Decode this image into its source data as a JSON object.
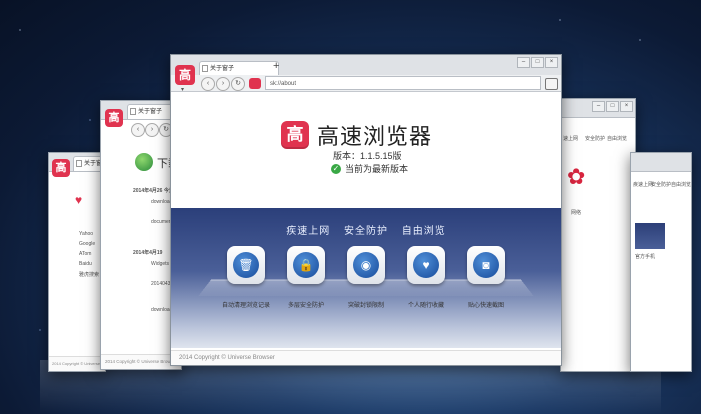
{
  "app": {
    "logo_char": "高",
    "title": "高速浏览器",
    "version": "版本：1.1.5.15版",
    "status": "当前为最新版本",
    "footer": "2014 Copyright © Universe Browser"
  },
  "main_window": {
    "tab_label": "关于窗子",
    "new_tab": "+",
    "address": "sk://about",
    "window_controls": [
      "–",
      "□",
      "×"
    ]
  },
  "slogan": [
    "疾速上网",
    "安全防护",
    "自由浏览"
  ],
  "features": [
    {
      "icon": "trash-icon",
      "glyph": "🗑",
      "label": "自动清理浏览记录"
    },
    {
      "icon": "lock-icon",
      "glyph": "🔒",
      "label": "多层安全防护"
    },
    {
      "icon": "globe-icon",
      "glyph": "◉",
      "label": "突破封锁限制"
    },
    {
      "icon": "heart-icon",
      "glyph": "♥",
      "label": "个人随行收藏"
    },
    {
      "icon": "camera-icon",
      "glyph": "◙",
      "label": "贴心快速截图"
    }
  ],
  "left_window": {
    "tab_label": "关于窗子",
    "heading": "下载",
    "sections": [
      {
        "date": "2014年4月26  今天",
        "items": [
          "download",
          "document"
        ]
      },
      {
        "date": "2014年4月19",
        "items": [
          "Widgets",
          "2014043",
          "download"
        ]
      }
    ],
    "footer": "2014 Copyright © Universe Browser"
  },
  "far_left_window": {
    "items": [
      "Yahoo",
      "Google",
      "ATom",
      "Baidu",
      "雅虎搜索"
    ],
    "footer": "2014 Copyright © Universe Br"
  },
  "right_window": {
    "menu": [
      "速上网",
      "安全防护",
      "自由浏览"
    ],
    "label": "网络"
  },
  "far_right_window": {
    "menu": [
      "疾速上网",
      "安全防护",
      "自由浏览"
    ],
    "label": "官方手机"
  }
}
